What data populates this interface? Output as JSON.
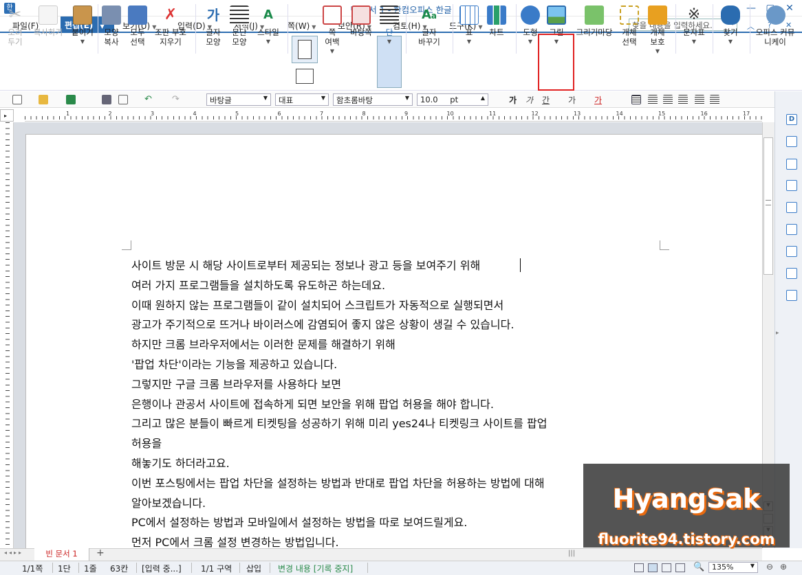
{
  "window": {
    "title": "빈 문서 1 - 한컴오피스 한글"
  },
  "menubar": {
    "items": [
      "파일(F)",
      "편집(E)",
      "보기(U)",
      "입력(D)",
      "서식(J)",
      "쪽(W)",
      "보안(R)",
      "검토(H)",
      "도구(K)"
    ],
    "search_placeholder": "찾을 내용을 입력하세요."
  },
  "ribbon": {
    "cut": "오려 두기",
    "copy": "복사하기",
    "paste": "붙이기",
    "format_copy": "모양 복사",
    "select_all": "모두 선택",
    "clear_code": "조판 부호 지우기",
    "char_shape": "글자 모양",
    "para_shape": "문단 모양",
    "style": "스타일",
    "page_margin": "쪽 여백",
    "background": "바탕쪽",
    "column": "단",
    "char_change": "글자 바꾸기",
    "table": "표",
    "chart": "차트",
    "shape": "도형",
    "picture": "그림",
    "drawing_market": "그리기마당",
    "obj_select": "개체 선택",
    "obj_protect": "개체 보호",
    "symbol": "문자표",
    "find": "찾기",
    "community": "오피스 커뮤니케이"
  },
  "toolbar2": {
    "style_value": "바탕글",
    "lang_value": "대표",
    "font_value": "함초롬바탕",
    "size_value": "10.0",
    "size_unit": "pt"
  },
  "ruler": {
    "numbers": [
      "1",
      "2",
      "3",
      "4",
      "5",
      "6",
      "7",
      "8",
      "9",
      "10",
      "11",
      "12",
      "13",
      "14",
      "15",
      "16",
      "17"
    ]
  },
  "document": {
    "lines": [
      "사이트 방문 시 해당 사이트로부터 제공되는 정보나 광고 등을 보여주기 위해",
      "여러 가지 프로그램들을 설치하도록 유도하곤 하는데요.",
      "이때 원하지 않는 프로그램들이 같이 설치되어 스크립트가 자동적으로 실행되면서",
      " 광고가 주기적으로 뜨거나 바이러스에 감염되어 좋지 않은 상황이 생길 수 있습니다.",
      "하지만 크롬 브라우저에서는 이러한 문제를 해결하기 위해",
      "'팝업 차단'이라는 기능을 제공하고 있습니다.",
      "그렇지만 구글 크롬 브라우저를 사용하다 보면",
      "은행이나 관공서 사이트에 접속하게 되면 보안을 위해 팝업 허용을 해야 합니다.",
      "그리고 많은 분들이 빠르게 티켓팅을 성공하기 위해  미리 yes24나 티켓링크 사이트를 팝업",
      "허용을",
      "해놓기도 하더라고요.",
      " 이번 포스팅에서는 팝업 차단을 설정하는 방법과 반대로 팝업 차단을 허용하는 방법에 대해",
      "알아보겠습니다.",
      "PC에서 설정하는 방법과 모바일에서 설정하는 방법을 따로 보여드릴게요.",
      " 먼저 PC에서 크롬 설정 변경하는 방법입니다."
    ]
  },
  "tabs": {
    "doc_tab": "빈 문서 1",
    "add": "+"
  },
  "statusbar": {
    "page": "1/1쪽",
    "col": "1단",
    "line": "1줄",
    "char": "63칸",
    "input": "[입력 중...]",
    "section": "1/1 구역",
    "insert": "삽입",
    "track": "변경 내용 [기록 중지]",
    "zoom": "135%"
  },
  "watermark": {
    "name": "HyangSak",
    "url": "fluorite94.tistory.com"
  },
  "colors": {
    "accent": "#2b6cb0",
    "highlight": "#e02020",
    "watermark_orange": "#e86a10"
  }
}
